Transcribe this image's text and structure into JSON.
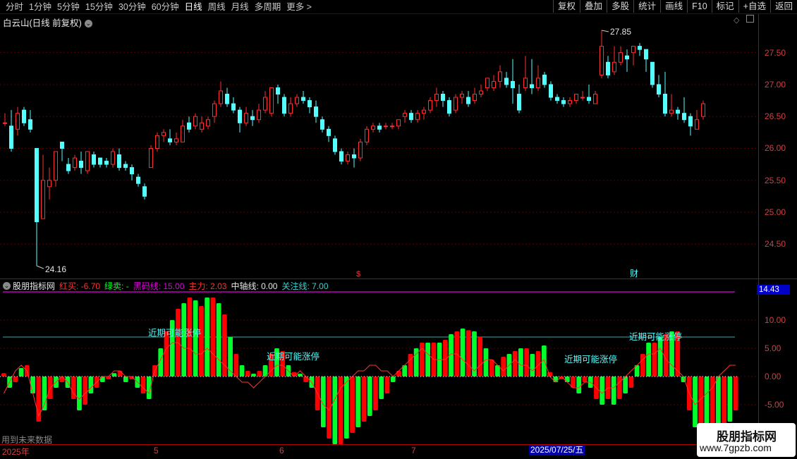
{
  "toolbar": {
    "periods": [
      "分时",
      "1分钟",
      "5分钟",
      "15分钟",
      "30分钟",
      "60分钟",
      "日线",
      "周线",
      "月线",
      "多周期",
      "更多 >"
    ],
    "active_period": "日线",
    "functions": [
      "复权",
      "叠加",
      "多股",
      "统计",
      "画线",
      "F10",
      "标记",
      "+自选",
      "返回"
    ]
  },
  "main": {
    "title": "白云山(日线 前复权)",
    "high_label": "27.85",
    "low_label": "24.16",
    "marker_dollar": "$",
    "marker_finance": "财",
    "y_ticks": [
      "27.50",
      "27.00",
      "26.50",
      "26.00",
      "25.50",
      "25.00",
      "24.50"
    ]
  },
  "indicator": {
    "name": "股朋指标网",
    "red_buy": "红买: -6.70",
    "green_sell": "绿卖: -",
    "black_horse": "黑码线: 15.00",
    "main_force": "主力: 2.03",
    "mid_axis": "中轴线: 0.00",
    "focus_line": "关注线: 7.00",
    "badge": "14.43",
    "y_ticks": [
      "10.00",
      "5.00",
      "0.00",
      "-5.00"
    ],
    "annotation": "近期可能涨停"
  },
  "dates": {
    "year": "2025年",
    "months": [
      "5",
      "6",
      "7"
    ],
    "highlight": "2025/07/25/五"
  },
  "notes": {
    "future": "用到未来数据"
  },
  "watermark": {
    "line1": "股朋指标网",
    "line2": "www.7gpzb.com"
  },
  "colors": {
    "up": "#ff3030",
    "down": "#54ffff",
    "bar_red": "#ff0000",
    "bar_green": "#00ff2a",
    "black_horse_line": "#e000e0",
    "focus_line": "#3aa8a8",
    "axis": "#b00000"
  },
  "chart_data": {
    "type": "candlestick",
    "title": "白云山(日线 前复权)",
    "ylim": [
      24.16,
      27.85
    ],
    "candles": [
      [
        26.4,
        26.4,
        26.55,
        26.35
      ],
      [
        26.35,
        26.0,
        26.6,
        25.95
      ],
      [
        26.3,
        26.55,
        26.65,
        26.2
      ],
      [
        26.6,
        26.4,
        26.65,
        26.35
      ],
      [
        26.45,
        26.3,
        26.6,
        26.25
      ],
      [
        26.0,
        24.85,
        26.0,
        24.16
      ],
      [
        24.9,
        25.5,
        25.9,
        24.9
      ],
      [
        25.4,
        25.5,
        25.7,
        25.2
      ],
      [
        25.5,
        25.95,
        25.95,
        25.4
      ],
      [
        26.1,
        26.0,
        26.1,
        25.8
      ],
      [
        25.75,
        25.65,
        25.85,
        25.6
      ],
      [
        25.7,
        25.85,
        25.9,
        25.65
      ],
      [
        25.8,
        25.7,
        25.95,
        25.6
      ],
      [
        25.65,
        25.95,
        25.95,
        25.6
      ],
      [
        25.9,
        25.75,
        25.95,
        25.7
      ],
      [
        25.85,
        25.75,
        25.85,
        25.7
      ],
      [
        25.8,
        25.75,
        25.85,
        25.7
      ],
      [
        25.75,
        25.95,
        26.0,
        25.7
      ],
      [
        25.9,
        25.7,
        26.0,
        25.65
      ],
      [
        25.75,
        25.7,
        25.8,
        25.65
      ],
      [
        25.7,
        25.6,
        25.75,
        25.5
      ],
      [
        25.55,
        25.45,
        25.6,
        25.4
      ],
      [
        25.4,
        25.25,
        25.45,
        25.2
      ],
      [
        25.7,
        26.0,
        26.05,
        25.7
      ],
      [
        26.0,
        26.2,
        26.25,
        25.95
      ],
      [
        26.2,
        26.25,
        26.3,
        26.1
      ],
      [
        26.15,
        26.1,
        26.3,
        26.05
      ],
      [
        26.1,
        26.15,
        26.25,
        26.05
      ],
      [
        26.1,
        26.35,
        26.45,
        26.1
      ],
      [
        26.4,
        26.3,
        26.5,
        26.25
      ],
      [
        26.35,
        26.5,
        26.55,
        26.3
      ],
      [
        26.3,
        26.4,
        26.5,
        26.25
      ],
      [
        26.35,
        26.45,
        26.5,
        26.3
      ],
      [
        26.5,
        26.7,
        26.75,
        26.4
      ],
      [
        26.7,
        26.9,
        27.05,
        26.65
      ],
      [
        26.85,
        26.7,
        26.95,
        26.65
      ],
      [
        26.7,
        26.6,
        26.8,
        26.55
      ],
      [
        26.6,
        26.4,
        26.65,
        26.25
      ],
      [
        26.4,
        26.55,
        26.65,
        26.35
      ],
      [
        26.5,
        26.45,
        26.6,
        26.35
      ],
      [
        26.45,
        26.6,
        26.7,
        26.4
      ],
      [
        26.6,
        26.8,
        26.9,
        26.55
      ],
      [
        26.55,
        26.95,
        26.95,
        26.5
      ],
      [
        26.95,
        26.85,
        27.0,
        26.7
      ],
      [
        26.8,
        26.55,
        26.85,
        26.5
      ],
      [
        26.55,
        26.7,
        26.8,
        26.5
      ],
      [
        26.7,
        26.8,
        26.85,
        26.65
      ],
      [
        26.8,
        26.75,
        26.9,
        26.7
      ],
      [
        26.75,
        26.65,
        26.8,
        26.55
      ],
      [
        26.65,
        26.5,
        26.75,
        26.4
      ],
      [
        26.45,
        26.3,
        26.5,
        26.25
      ],
      [
        26.3,
        26.2,
        26.35,
        26.1
      ],
      [
        26.15,
        25.95,
        26.2,
        25.9
      ],
      [
        25.95,
        25.8,
        26.0,
        25.75
      ],
      [
        25.8,
        25.9,
        25.95,
        25.75
      ],
      [
        25.9,
        25.85,
        26.0,
        25.7
      ],
      [
        25.85,
        26.1,
        26.15,
        25.8
      ],
      [
        26.1,
        26.3,
        26.35,
        26.05
      ],
      [
        26.3,
        26.35,
        26.4,
        26.25
      ],
      [
        26.35,
        26.3,
        26.4,
        26.25
      ],
      [
        26.35,
        26.35,
        26.4,
        26.3
      ],
      [
        26.35,
        26.35,
        26.4,
        26.3
      ],
      [
        26.35,
        26.45,
        26.45,
        26.3
      ],
      [
        26.5,
        26.55,
        26.6,
        26.4
      ],
      [
        26.55,
        26.45,
        26.6,
        26.4
      ],
      [
        26.45,
        26.55,
        26.6,
        26.4
      ],
      [
        26.55,
        26.6,
        26.65,
        26.45
      ],
      [
        26.6,
        26.75,
        26.8,
        26.55
      ],
      [
        26.75,
        26.85,
        26.95,
        26.65
      ],
      [
        26.85,
        26.75,
        26.9,
        26.65
      ],
      [
        26.75,
        26.55,
        26.8,
        26.5
      ],
      [
        26.6,
        26.8,
        26.85,
        26.55
      ],
      [
        26.8,
        26.85,
        26.9,
        26.7
      ],
      [
        26.8,
        26.7,
        26.9,
        26.65
      ],
      [
        26.75,
        26.85,
        26.95,
        26.7
      ],
      [
        26.85,
        26.9,
        27.0,
        26.8
      ],
      [
        26.95,
        27.1,
        27.1,
        26.9
      ],
      [
        26.95,
        27.05,
        27.15,
        26.9
      ],
      [
        27.05,
        27.2,
        27.3,
        26.95
      ],
      [
        27.1,
        27.0,
        27.2,
        26.95
      ],
      [
        27.05,
        26.95,
        27.4,
        26.7
      ],
      [
        26.85,
        26.6,
        27.0,
        26.55
      ],
      [
        26.95,
        27.1,
        27.45,
        26.9
      ],
      [
        27.0,
        26.95,
        27.4,
        26.85
      ],
      [
        26.95,
        27.1,
        27.3,
        26.9
      ],
      [
        27.15,
        27.0,
        27.2,
        26.95
      ],
      [
        27.0,
        26.8,
        27.05,
        26.75
      ],
      [
        26.8,
        26.75,
        26.85,
        26.7
      ],
      [
        26.75,
        26.7,
        26.8,
        26.65
      ],
      [
        26.7,
        26.75,
        26.8,
        26.65
      ],
      [
        26.75,
        26.85,
        26.85,
        26.7
      ],
      [
        26.8,
        26.8,
        26.9,
        26.75
      ],
      [
        26.8,
        26.75,
        27.0,
        26.7
      ],
      [
        26.7,
        26.85,
        26.9,
        26.7
      ],
      [
        27.15,
        27.6,
        27.85,
        27.1
      ],
      [
        27.35,
        27.15,
        27.45,
        27.1
      ],
      [
        27.2,
        27.35,
        27.6,
        27.15
      ],
      [
        27.35,
        27.5,
        27.6,
        27.3
      ],
      [
        27.45,
        27.4,
        27.55,
        27.2
      ],
      [
        27.5,
        27.6,
        27.6,
        27.3
      ],
      [
        27.6,
        27.55,
        27.65,
        27.45
      ],
      [
        27.55,
        27.4,
        27.55,
        27.2
      ],
      [
        27.35,
        27.0,
        27.35,
        26.95
      ],
      [
        27.0,
        26.85,
        27.15,
        26.8
      ],
      [
        26.85,
        26.55,
        27.2,
        26.5
      ],
      [
        26.55,
        26.6,
        26.85,
        26.5
      ],
      [
        26.6,
        26.55,
        26.65,
        26.45
      ],
      [
        26.55,
        26.45,
        26.8,
        26.4
      ],
      [
        26.5,
        26.35,
        26.55,
        26.2
      ],
      [
        26.3,
        26.45,
        26.6,
        26.3
      ],
      [
        26.5,
        26.7,
        26.75,
        26.45
      ]
    ]
  },
  "indicator_data": {
    "ylim": [
      -12,
      15
    ],
    "black_horse": 15.0,
    "focus": 7.0,
    "bars": [
      0.6,
      -2,
      -1,
      1.5,
      2,
      -3,
      -8,
      -6,
      -4,
      -2,
      -1,
      -2,
      -4,
      -6,
      -5,
      -3,
      -2,
      -1,
      -0.5,
      0.6,
      1,
      -1,
      -0.5,
      -2,
      -3,
      -4,
      2,
      5,
      8,
      10,
      12,
      13,
      14,
      13.5,
      12.5,
      14,
      14,
      13,
      11,
      7,
      4,
      2,
      1,
      0.5,
      1,
      2,
      4,
      5,
      4.5,
      2,
      0.8,
      0.5,
      -1,
      -2,
      -6,
      -9,
      -11,
      -12,
      -12,
      -11,
      -10,
      -9,
      -8,
      -7,
      -6,
      -4,
      -3,
      -1,
      1,
      2,
      4,
      5,
      6,
      6,
      6,
      6,
      6.5,
      7.5,
      8,
      8.5,
      8.2,
      8,
      7,
      5,
      3,
      2,
      3.5,
      4,
      4.5,
      5,
      5,
      4,
      4.5,
      5.5,
      0.8,
      -1,
      -0.5,
      -1,
      -2,
      -3,
      -1,
      -2,
      -4,
      -5,
      -4,
      -5,
      -4,
      -3,
      -2,
      2,
      4,
      6,
      6,
      7,
      7.5,
      8,
      8,
      -1,
      -6,
      -9,
      -10,
      -11,
      -11,
      -10,
      -9,
      -8,
      -6
    ],
    "main_force": [
      -3,
      -1,
      1,
      2,
      1,
      -3,
      -7,
      -5,
      -2,
      -1,
      0,
      -1,
      -3,
      -4,
      -3,
      -2,
      -1,
      0,
      0,
      1,
      1,
      0,
      0,
      -1,
      -2,
      -3,
      1,
      3,
      5,
      6,
      6,
      5,
      5,
      4,
      4,
      5,
      4,
      3,
      2,
      1,
      0,
      -1,
      -1,
      -2,
      -1,
      0,
      1,
      2,
      2,
      1,
      0,
      1,
      0,
      -1,
      -3,
      -5,
      -6,
      -4,
      -2,
      -1,
      0,
      1,
      1,
      2,
      2,
      1,
      1,
      0,
      1,
      2,
      3,
      4,
      5,
      4,
      3,
      3,
      3,
      4,
      4,
      3,
      2,
      1,
      2,
      3,
      3,
      2,
      1,
      2,
      3,
      2,
      2,
      1,
      2,
      3,
      0,
      -1,
      0,
      -1,
      -2,
      -2,
      -1,
      -1,
      -2,
      -3,
      -2,
      -2,
      -1,
      0,
      1,
      2,
      3,
      4,
      4,
      5,
      3,
      2,
      1,
      0,
      -3,
      -5,
      -4,
      -3,
      -2,
      0,
      1,
      2,
      2
    ]
  }
}
